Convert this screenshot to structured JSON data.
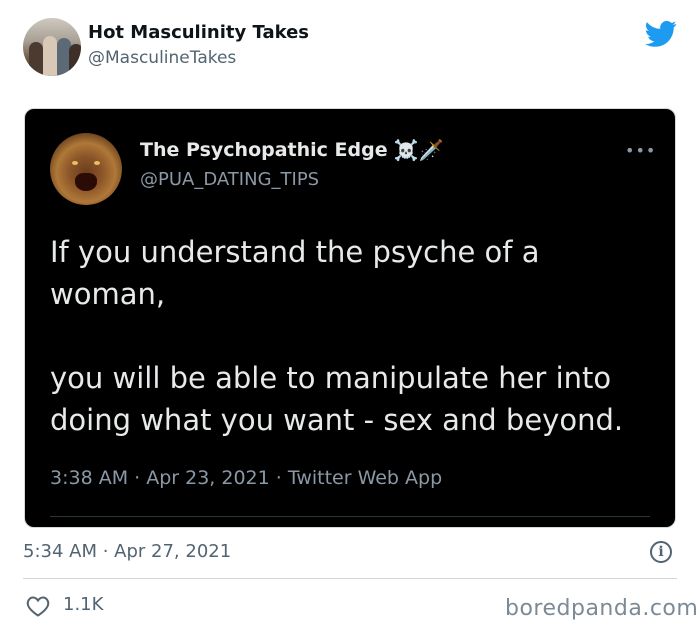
{
  "outer_tweet": {
    "display_name": "Hot Masculinity Takes",
    "handle": "@MasculineTakes",
    "timestamp": "5:34 AM · Apr 27, 2021",
    "like_count": "1.1K"
  },
  "embedded_tweet": {
    "display_name": "The Psychopathic Edge",
    "emojis": "☠️🗡️",
    "handle": "@PUA_DATING_TIPS",
    "text_line_1": "If you understand the psyche of a",
    "text_line_2": "woman,",
    "text_line_3": "you will be able to manipulate her into",
    "text_line_4": "doing what you want - sex and beyond.",
    "meta": "3:38 AM · Apr 23, 2021 · Twitter Web App",
    "more_label": "•••"
  },
  "watermark": "boredpanda.com",
  "icons": {
    "brand": "twitter-bird-icon",
    "info": "info-icon",
    "like": "heart-icon",
    "more": "more-icon"
  },
  "colors": {
    "brand": "#1d9bf0",
    "embed_bg": "#000000",
    "muted": "#536471"
  }
}
